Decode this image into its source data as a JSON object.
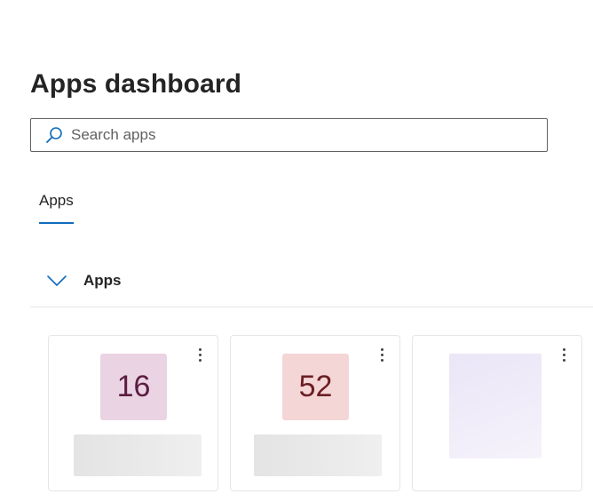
{
  "header": {
    "title": "Apps dashboard"
  },
  "search": {
    "placeholder": "Search apps",
    "value": ""
  },
  "tabs": [
    {
      "label": "Apps",
      "selected": true
    }
  ],
  "section": {
    "title": "Apps",
    "expanded": true
  },
  "cards": [
    {
      "tile_text": "16",
      "tile_color": "#ead3e2",
      "text_color": "#5b1c41"
    },
    {
      "tile_text": "52",
      "tile_color": "#f5d6d7",
      "text_color": "#6b1f24"
    },
    {
      "tile_text": "",
      "tile_color": "#ebe6f7"
    }
  ],
  "icons": {
    "search": "search-icon",
    "chevron": "chevron-down-icon",
    "more": "more-vertical-icon"
  },
  "colors": {
    "accent": "#0f6cbd",
    "border": "#616161",
    "divider": "#e6e6e6"
  }
}
